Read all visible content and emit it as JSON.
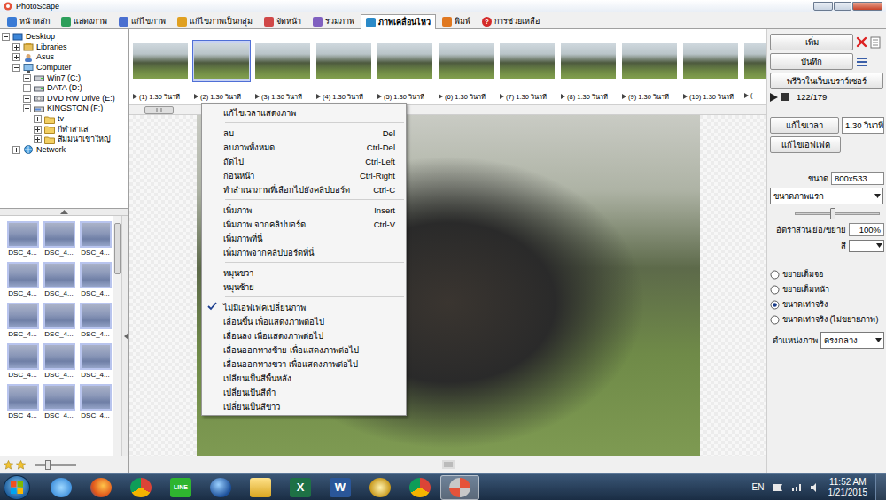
{
  "window": {
    "title": "PhotoScape"
  },
  "tabs": [
    {
      "label": "หน้าหลัก",
      "kind": "home",
      "selected": false
    },
    {
      "label": "แสดงภาพ",
      "kind": "viewer",
      "selected": false
    },
    {
      "label": "แก้ไขภาพ",
      "kind": "editor",
      "selected": false
    },
    {
      "label": "แก้ไขภาพเป็นกลุ่ม",
      "kind": "batch",
      "selected": false
    },
    {
      "label": "จัดหน้า",
      "kind": "page",
      "selected": false
    },
    {
      "label": "รวมภาพ",
      "kind": "combine",
      "selected": false
    },
    {
      "label": "ภาพเคลื่อนไหว",
      "kind": "gif",
      "selected": true
    },
    {
      "label": "พิมพ์",
      "kind": "print",
      "selected": false
    },
    {
      "label": "การช่วยเหลือ",
      "kind": "help",
      "glyph": "?",
      "selected": false
    }
  ],
  "folder_tree": [
    {
      "label": "Desktop",
      "kind": "desktop",
      "expanded": true,
      "children": [
        {
          "label": "Libraries",
          "kind": "library",
          "expanded": false,
          "children": []
        },
        {
          "label": "Asus",
          "kind": "user",
          "expanded": false,
          "children": []
        },
        {
          "label": "Computer",
          "kind": "computer",
          "expanded": true,
          "children": [
            {
              "label": "Win7 (C:)",
              "kind": "drive",
              "expanded": false,
              "children": []
            },
            {
              "label": "DATA (D:)",
              "kind": "drive",
              "expanded": false,
              "children": []
            },
            {
              "label": "DVD RW Drive (E:)",
              "kind": "dvd",
              "expanded": false,
              "children": []
            },
            {
              "label": "KINGSTON (F:)",
              "kind": "usb",
              "expanded": true,
              "children": [
                {
                  "label": "tv--",
                  "kind": "folder",
                  "expanded": false,
                  "children": []
                },
                {
                  "label": "กีฬาสาเส",
                  "kind": "folder",
                  "expanded": false,
                  "children": []
                },
                {
                  "label": "สัมมนาเขาใหญ่",
                  "kind": "folder",
                  "expanded": false,
                  "children": []
                }
              ]
            }
          ]
        },
        {
          "label": "Network",
          "kind": "network",
          "expanded": false,
          "children": []
        }
      ]
    }
  ],
  "thumbnails": [
    "DSC_4...",
    "DSC_4...",
    "DSC_4...",
    "DSC_4...",
    "DSC_4...",
    "DSC_4...",
    "DSC_4...",
    "DSC_4...",
    "DSC_4...",
    "DSC_4...",
    "DSC_4...",
    "DSC_4...",
    "DSC_4...",
    "DSC_4...",
    "DSC_4..."
  ],
  "thumb_size": {
    "level": 0.3
  },
  "frames": [
    {
      "label": "(1) 1.30 วินาที",
      "selected": false
    },
    {
      "label": "(2) 1.30 วินาที",
      "selected": true
    },
    {
      "label": "(3) 1.30 วินาที",
      "selected": false
    },
    {
      "label": "(4) 1.30 วินาที",
      "selected": false
    },
    {
      "label": "(5) 1.30 วินาที",
      "selected": false
    },
    {
      "label": "(6) 1.30 วินาที",
      "selected": false
    },
    {
      "label": "(7) 1.30 วินาที",
      "selected": false
    },
    {
      "label": "(8) 1.30 วินาที",
      "selected": false
    },
    {
      "label": "(9) 1.30 วินาที",
      "selected": false
    },
    {
      "label": "(10) 1.30 วินาที",
      "selected": false
    },
    {
      "label": "(",
      "selected": false
    }
  ],
  "context_menu": [
    {
      "kind": "item",
      "label": "แก้ไขเวลาแสดงภาพ",
      "shortcut": "",
      "checked": false
    },
    {
      "kind": "separator"
    },
    {
      "kind": "item",
      "label": "ลบ",
      "shortcut": "Del",
      "checked": false
    },
    {
      "kind": "item",
      "label": "ลบภาพทั้งหมด",
      "shortcut": "Ctrl-Del",
      "checked": false
    },
    {
      "kind": "item",
      "label": "ถัดไป",
      "shortcut": "Ctrl-Left",
      "checked": false
    },
    {
      "kind": "item",
      "label": "ก่อนหน้า",
      "shortcut": "Ctrl-Right",
      "checked": false
    },
    {
      "kind": "item",
      "label": "ทำสำเนาภาพที่เลือกไปยังคลิปบอร์ด",
      "shortcut": "Ctrl-C",
      "checked": false
    },
    {
      "kind": "separator"
    },
    {
      "kind": "item",
      "label": "เพิ่มภาพ",
      "shortcut": "Insert",
      "checked": false
    },
    {
      "kind": "item",
      "label": "เพิ่มภาพ จากคลิปบอร์ด",
      "shortcut": "Ctrl-V",
      "checked": false
    },
    {
      "kind": "item",
      "label": "เพิ่มภาพที่นี่",
      "shortcut": "",
      "checked": false
    },
    {
      "kind": "item",
      "label": "เพิ่มภาพจากคลิปบอร์ดที่นี่",
      "shortcut": "",
      "checked": false
    },
    {
      "kind": "separator"
    },
    {
      "kind": "item",
      "label": "หมุนขวา",
      "shortcut": "",
      "checked": false
    },
    {
      "kind": "item",
      "label": "หมุนซ้าย",
      "shortcut": "",
      "checked": false
    },
    {
      "kind": "separator"
    },
    {
      "kind": "item",
      "label": "ไม่มีเอฟเฟคเปลี่ยนภาพ",
      "shortcut": "",
      "checked": true
    },
    {
      "kind": "item",
      "label": "เลื่อนขึ้น เพื่อแสดงภาพต่อไป",
      "shortcut": "",
      "checked": false
    },
    {
      "kind": "item",
      "label": "เลื่อนลง เพื่อแสดงภาพต่อไป",
      "shortcut": "",
      "checked": false
    },
    {
      "kind": "item",
      "label": "เลื่อนออกทางซ้าย เพื่อแสดงภาพต่อไป",
      "shortcut": "",
      "checked": false
    },
    {
      "kind": "item",
      "label": "เลื่อนออกทางขวา เพื่อแสดงภาพต่อไป",
      "shortcut": "",
      "checked": false
    },
    {
      "kind": "item",
      "label": "เปลี่ยนเป็นสีพื้นหลัง",
      "shortcut": "",
      "checked": false
    },
    {
      "kind": "item",
      "label": "เปลี่ยนเป็นสีดำ",
      "shortcut": "",
      "checked": false
    },
    {
      "kind": "item",
      "label": "เปลี่ยนเป็นสีขาว",
      "shortcut": "",
      "checked": false
    }
  ],
  "controls": {
    "add": "เพิ่ม",
    "save": "บันทึก",
    "preview": "พรีวิวในเว็บเบราว์เซอร์",
    "counter": "122/179",
    "edit_time": "แก้ไขเวลา",
    "time_value": "1.30 วินาที",
    "edit_effect": "แก้ไขเอฟเฟค",
    "size_label": "ขนาด",
    "size_value": "800x533",
    "size_mode": "ขนาดภาพแรก",
    "size_slider": {
      "level": 0.45
    },
    "zoom_label": "อัตราส่วน ย่อ/ขยาย",
    "zoom_value": "100%",
    "color_label": "สี",
    "color_value": "#ffffff",
    "fit_options": [
      {
        "label": "ขยายเต็มจอ",
        "selected": false
      },
      {
        "label": "ขยายเต็มหน้า",
        "selected": false
      },
      {
        "label": "ขนาดเท่าจริง",
        "selected": true
      },
      {
        "label": "ขนาดเท่าจริง (ไม่ขยายภาพ)",
        "selected": false
      }
    ],
    "position_label": "ตำแหน่งภาพ",
    "position_value": "ตรงกลาง"
  },
  "taskbar": {
    "apps": [
      {
        "kind": "ie",
        "active": false
      },
      {
        "kind": "firefox",
        "active": false
      },
      {
        "kind": "chrome",
        "active": false
      },
      {
        "kind": "line",
        "glyph": "LINE",
        "active": false
      },
      {
        "kind": "earth",
        "active": false
      },
      {
        "kind": "explorer",
        "active": false
      },
      {
        "kind": "excel",
        "glyph": "X",
        "active": false
      },
      {
        "kind": "word",
        "glyph": "W",
        "active": false
      },
      {
        "kind": "disc",
        "active": false
      },
      {
        "kind": "chrome",
        "active": false
      },
      {
        "kind": "photoscape",
        "active": true
      }
    ],
    "language": "EN",
    "time": "11:52 AM",
    "date": "1/21/2015"
  }
}
